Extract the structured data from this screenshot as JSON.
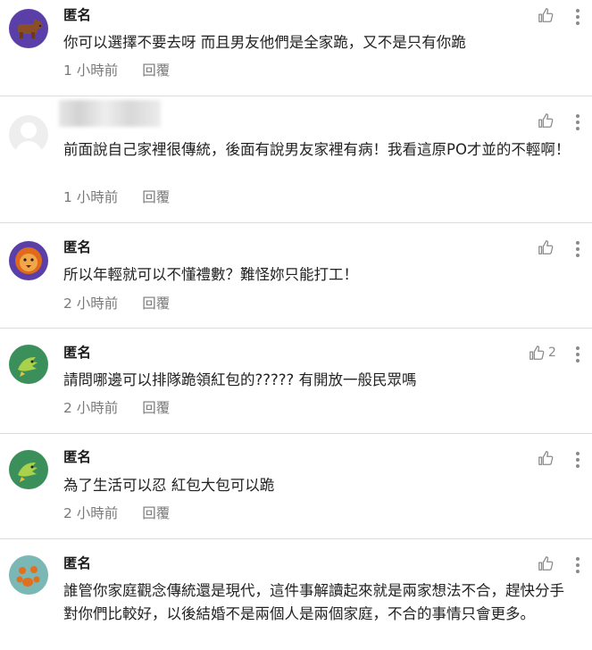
{
  "comments": [
    {
      "author": "匿名",
      "text": "你可以選擇不要去呀 而且男友他們是全家跪，又不是只有你跪",
      "time": "1 小時前",
      "reply": "回覆",
      "avatar_icon": "bear-icon",
      "avatar_bg": "#5a3fa8",
      "likes": ""
    },
    {
      "author": "",
      "text": "前面說自己家裡很傳統，後面有說男友家裡有病！我看這原PO才並的不輕啊！",
      "time": "1 小時前",
      "reply": "回覆",
      "avatar_icon": "default-user-icon",
      "avatar_bg": "#eeeeee",
      "likes": ""
    },
    {
      "author": "匿名",
      "text": "所以年輕就可以不懂禮數？難怪妳只能打工！",
      "time": "2 小時前",
      "reply": "回覆",
      "avatar_icon": "lion-icon",
      "avatar_bg": "#5a3fa8",
      "likes": ""
    },
    {
      "author": "匿名",
      "text": "請問哪邊可以排隊跪領紅包的????? 有開放一般民眾嗎",
      "time": "2 小時前",
      "reply": "回覆",
      "avatar_icon": "dragon-icon",
      "avatar_bg": "#3b8f5a",
      "likes": "2"
    },
    {
      "author": "匿名",
      "text": "為了生活可以忍 紅包大包可以跪",
      "time": "2 小時前",
      "reply": "回覆",
      "avatar_icon": "dragon-icon",
      "avatar_bg": "#3b8f5a",
      "likes": ""
    },
    {
      "author": "匿名",
      "text": "誰管你家庭觀念傳統還是現代，這件事解讀起來就是兩家想法不合，趕快分手對你們比較好，以後結婚不是兩個人是兩個家庭，不合的事情只會更多。",
      "time": "",
      "reply": "",
      "avatar_icon": "paw-icon",
      "avatar_bg": "#7bb7b5",
      "likes": ""
    }
  ]
}
